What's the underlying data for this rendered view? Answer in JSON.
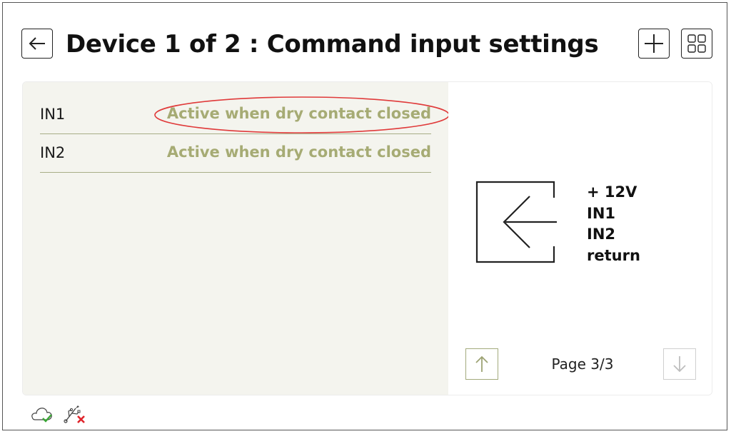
{
  "header": {
    "title": "Device 1 of 2 : Command input settings",
    "back_icon": "arrow-left-icon",
    "add_icon": "plus-icon",
    "grid_icon": "grid-view-icon"
  },
  "inputs": [
    {
      "name": "IN1",
      "mode": "Active when dry contact closed",
      "highlighted": true
    },
    {
      "name": "IN2",
      "mode": "Active when dry contact closed",
      "highlighted": false
    }
  ],
  "diagram": {
    "icon": "input-arrow-icon",
    "terminals": [
      "+ 12V",
      "IN1",
      "IN2",
      "return"
    ]
  },
  "pager": {
    "label": "Page 3/3",
    "up_icon": "arrow-up-icon",
    "down_icon": "arrow-down-icon",
    "down_disabled": true
  },
  "status": {
    "cloud_icon": "cloud-connected-icon",
    "usb_icon": "usb-disconnected-icon"
  },
  "colors": {
    "accent": "#a6ab74",
    "panel_bg": "#f4f4ee",
    "highlight": "#e03a3a",
    "ok": "#3aa636",
    "error": "#e0242b"
  }
}
